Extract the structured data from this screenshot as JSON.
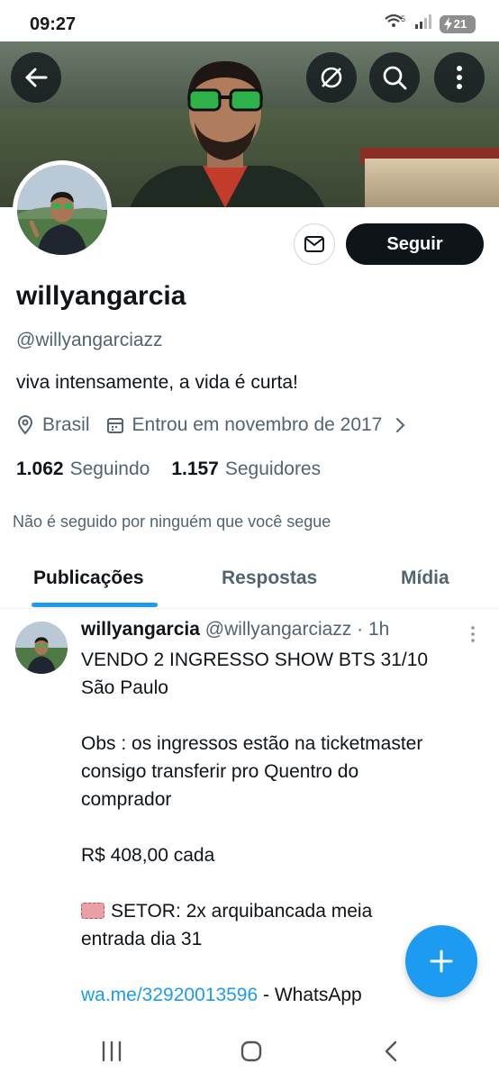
{
  "status_bar": {
    "time": "09:27",
    "battery": "21",
    "wifi_label": "5"
  },
  "header_icons": [
    "back-arrow-icon",
    "grok-icon",
    "search-icon",
    "more-vertical-icon"
  ],
  "profile": {
    "display_name": "willyangarcia",
    "handle": "@willyangarciazz",
    "bio": "viva intensamente, a vida é curta!",
    "location": "Brasil",
    "joined": "Entrou em novembro de 2017",
    "following_count": "1.062",
    "following_label": "Seguindo",
    "followers_count": "1.157",
    "followers_label": "Seguidores",
    "not_followed_text": "Não é seguido por ninguém que você segue"
  },
  "actions": {
    "follow_label": "Seguir"
  },
  "tabs": [
    {
      "label": "Publicações",
      "active": true
    },
    {
      "label": "Respostas",
      "active": false
    },
    {
      "label": "Mídia",
      "active": false
    }
  ],
  "post": {
    "author_name": "willyangarcia",
    "author_handle": "@willyangarciazz",
    "separator": "·",
    "time": "1h",
    "lines": {
      "l1": "VENDO 2 INGRESSO SHOW BTS 31/10",
      "l2": "São Paulo",
      "l3": "Obs : os ingressos estão na ticketmaster",
      "l4": "consigo transferir pro Quentro do",
      "l5": "comprador",
      "l6": "R$ 408,00 cada",
      "l7": "SETOR: 2x arquibancada meia",
      "l8": "entrada dia 31",
      "link": "wa.me/32920013596",
      "link_suffix": " - WhatsApp"
    }
  },
  "colors": {
    "accent": "#1d9bf0",
    "text_primary": "#0f1419",
    "text_secondary": "#536471",
    "follow_button": "#0f1419"
  }
}
